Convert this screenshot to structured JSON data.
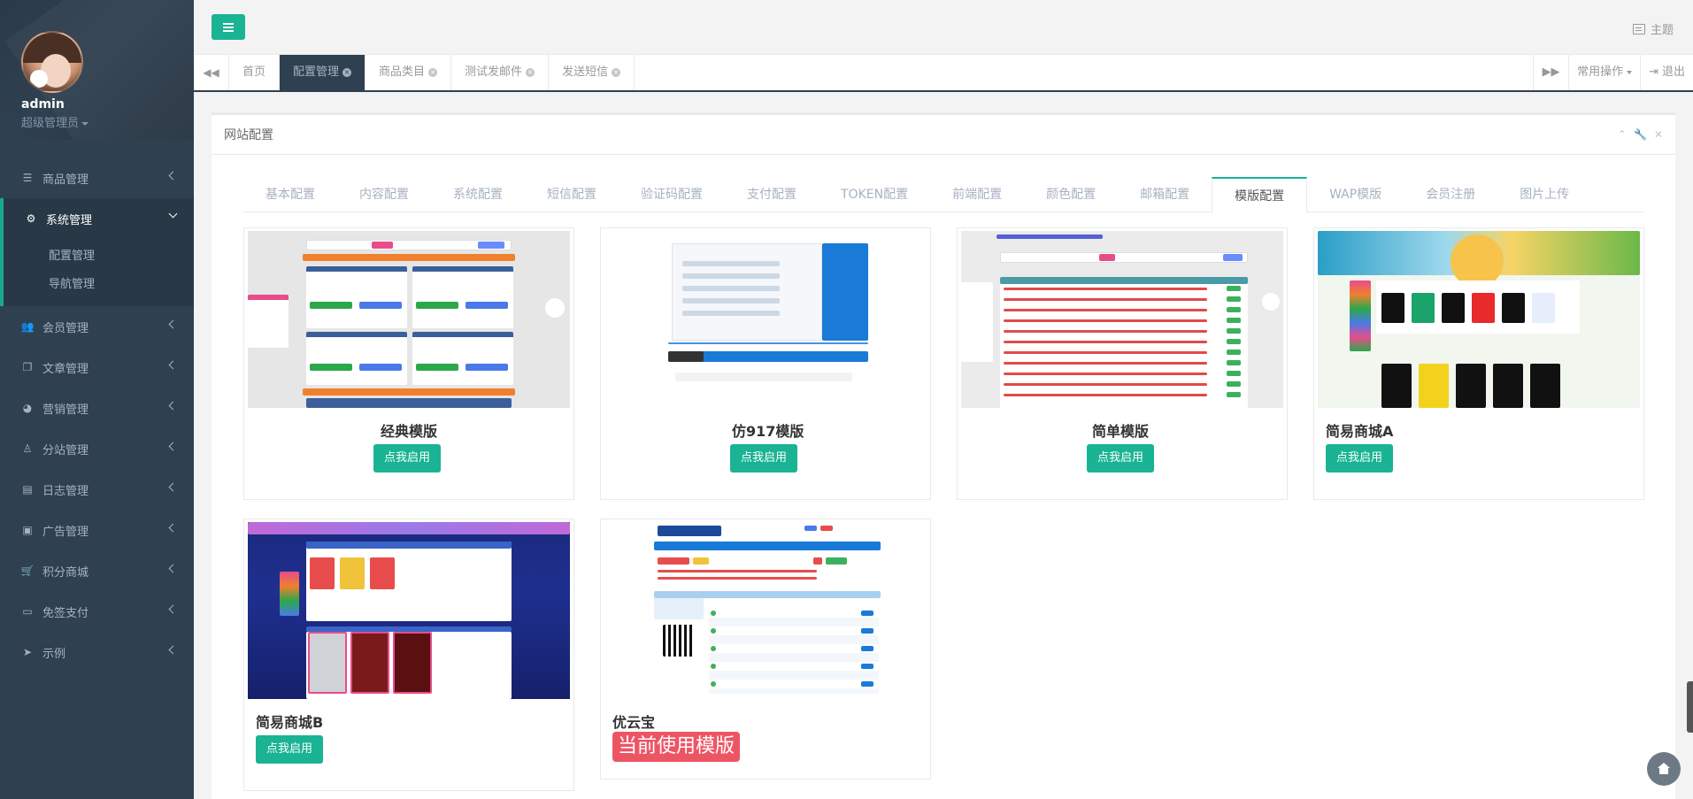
{
  "profile": {
    "name": "admin",
    "role": "超级管理员"
  },
  "nav": {
    "items": [
      {
        "label": "商品管理",
        "icon": "list-icon"
      },
      {
        "label": "系统管理",
        "icon": "gear-icon",
        "active": true,
        "children": [
          "配置管理",
          "导航管理"
        ]
      },
      {
        "label": "会员管理",
        "icon": "users-icon"
      },
      {
        "label": "文章管理",
        "icon": "copy-icon"
      },
      {
        "label": "营销管理",
        "icon": "pie-chart-icon"
      },
      {
        "label": "分站管理",
        "icon": "child-icon"
      },
      {
        "label": "日志管理",
        "icon": "server-icon"
      },
      {
        "label": "广告管理",
        "icon": "image-icon"
      },
      {
        "label": "积分商城",
        "icon": "cart-icon"
      },
      {
        "label": "免签支付",
        "icon": "credit-card-icon"
      },
      {
        "label": "示例",
        "icon": "paper-plane-icon"
      }
    ]
  },
  "header": {
    "theme_label": "主题"
  },
  "tabs": {
    "items": [
      {
        "label": "首页",
        "closable": false
      },
      {
        "label": "配置管理",
        "closable": true,
        "active": true
      },
      {
        "label": "商品类目",
        "closable": true
      },
      {
        "label": "测试发邮件",
        "closable": true
      },
      {
        "label": "发送短信",
        "closable": true
      }
    ],
    "common_ops": "常用操作",
    "logout": "退出"
  },
  "panel": {
    "title": "网站配置",
    "config_tabs": [
      "基本配置",
      "内容配置",
      "系统配置",
      "短信配置",
      "验证码配置",
      "支付配置",
      "TOKEN配置",
      "前端配置",
      "颜色配置",
      "邮箱配置",
      "模版配置",
      "WAP模版",
      "会员注册",
      "图片上传"
    ],
    "active_config_tab": "模版配置"
  },
  "templates": [
    {
      "name": "经典模版",
      "button": "点我启用"
    },
    {
      "name": "仿917模版",
      "button": "点我启用"
    },
    {
      "name": "简单模版",
      "button": "点我启用"
    },
    {
      "name": "简易商城A",
      "button": "点我启用"
    },
    {
      "name": "简易商城B",
      "button": "点我启用"
    },
    {
      "name": "优云宝",
      "current_label": "当前使用模版"
    }
  ],
  "colors": {
    "accent": "#1ab394",
    "sidebar": "#2f4050",
    "current": "#ed5565"
  }
}
